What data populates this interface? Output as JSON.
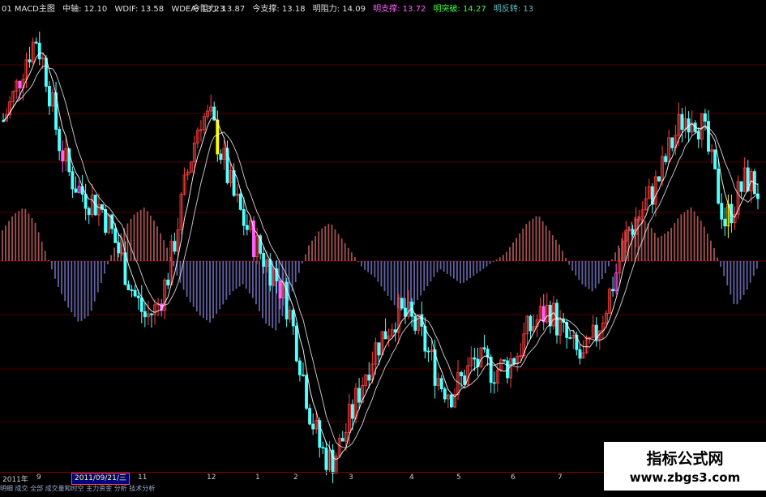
{
  "header": {
    "title": "01 MACD主图",
    "zhongzhou": "中轴: 12.10",
    "wdif": "WDIF: 13.58",
    "wdea": "WDEA: 13.23",
    "jin_zuli": "今阻力: 13.87",
    "jin_zhicheng": "今支撑: 13.18",
    "ming_zuli": "明阻力: 14.09",
    "ming_zhicheng": "明支撑: 13.72",
    "ming_tupo": "明突破: 14.27",
    "ming_fanzhuan": "明反转: 13"
  },
  "colors": {
    "background": "#000000",
    "up_candle": "#ff4040",
    "down_candle": "#54ffff",
    "ma_line": "#ffffff",
    "macd_positive": "#a05050",
    "macd_negative": "#6060a0",
    "title": "#e0e0e0",
    "label_yellow": "#ffff00",
    "label_magenta": "#ff60ff",
    "label_green": "#40ff40",
    "label_cyan": "#60c0c0",
    "grid": "#800000"
  },
  "time_axis": {
    "year_label": "2011年",
    "ticks": [
      "9",
      "11",
      "12",
      "1",
      "2",
      "3",
      "4",
      "5",
      "6",
      "7"
    ],
    "selected_date": "2011/09/21/三"
  },
  "watermark": {
    "title": "指标公式网",
    "url": "www.zbgs3.com"
  },
  "status_bar": {
    "text": "明细  成交  全部  成交量和时空  主力资金  分析  技术分析"
  },
  "chart_data": {
    "type": "candlestick",
    "indicator": "MACD",
    "overlay_lines": [
      "MA short",
      "MA long"
    ],
    "histogram": "MACD bars above/below zero axis",
    "price_path_normalized": [
      0.78,
      0.84,
      0.92,
      0.97,
      0.88,
      0.74,
      0.66,
      0.62,
      0.6,
      0.58,
      0.52,
      0.45,
      0.38,
      0.33,
      0.35,
      0.42,
      0.55,
      0.68,
      0.79,
      0.78,
      0.7,
      0.61,
      0.55,
      0.5,
      0.46,
      0.42,
      0.36,
      0.25,
      0.12,
      0.03,
      0.0,
      0.05,
      0.12,
      0.2,
      0.26,
      0.3,
      0.34,
      0.33,
      0.3,
      0.24,
      0.18,
      0.16,
      0.19,
      0.23,
      0.22,
      0.21,
      0.22,
      0.25,
      0.3,
      0.33,
      0.35,
      0.3,
      0.26,
      0.23,
      0.28,
      0.35,
      0.43,
      0.52,
      0.56,
      0.6,
      0.65,
      0.72,
      0.78,
      0.8,
      0.76,
      0.65,
      0.55,
      0.6,
      0.65,
      0.62
    ],
    "macd_path_normalized": [
      0.4,
      0.6,
      0.7,
      0.5,
      0.1,
      -0.3,
      -0.6,
      -0.8,
      -0.7,
      -0.3,
      0.1,
      0.4,
      0.6,
      0.7,
      0.5,
      0.2,
      -0.2,
      -0.5,
      -0.7,
      -0.8,
      -0.6,
      -0.4,
      -0.3,
      -0.5,
      -0.8,
      -0.9,
      -0.6,
      -0.2,
      0.2,
      0.4,
      0.5,
      0.3,
      0.1,
      -0.1,
      -0.2,
      -0.4,
      -0.6,
      -0.7,
      -0.5,
      -0.3,
      -0.1,
      -0.2,
      -0.3,
      -0.2,
      -0.1,
      0.0,
      0.1,
      0.3,
      0.5,
      0.6,
      0.4,
      0.2,
      -0.1,
      -0.3,
      -0.4,
      -0.2,
      0.1,
      0.4,
      0.6,
      0.5,
      0.3,
      0.4,
      0.6,
      0.7,
      0.5,
      0.2,
      -0.2,
      -0.6,
      -0.4,
      -0.1
    ]
  }
}
